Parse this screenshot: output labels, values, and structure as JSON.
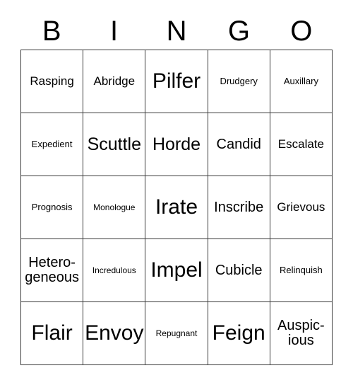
{
  "card": {
    "header_letters": [
      "B",
      "I",
      "N",
      "G",
      "O"
    ],
    "columns": 5,
    "rows": 5,
    "border_color": "#3a3a3a",
    "text_color": "#000000",
    "background_color": "#ffffff",
    "cells": [
      [
        {
          "text": "Rasping",
          "size": "sm"
        },
        {
          "text": "Abridge",
          "size": "sm"
        },
        {
          "text": "Pilfer",
          "size": "xl"
        },
        {
          "text": "Drudgery",
          "size": "xs"
        },
        {
          "text": "Auxillary",
          "size": "xs"
        }
      ],
      [
        {
          "text": "Expedient",
          "size": "xs"
        },
        {
          "text": "Scuttle",
          "size": "lg"
        },
        {
          "text": "Horde",
          "size": "lg"
        },
        {
          "text": "Candid",
          "size": "md"
        },
        {
          "text": "Escalate",
          "size": "sm"
        }
      ],
      [
        {
          "text": "Prognosis",
          "size": "xs"
        },
        {
          "text": "Monologue",
          "size": "xxs"
        },
        {
          "text": "Irate",
          "size": "xl"
        },
        {
          "text": "Inscribe",
          "size": "md"
        },
        {
          "text": "Grievous",
          "size": "sm"
        }
      ],
      [
        {
          "text": "Hetero-\ngeneous",
          "size": "md"
        },
        {
          "text": "Incredulous",
          "size": "xxs"
        },
        {
          "text": "Impel",
          "size": "xl"
        },
        {
          "text": "Cubicle",
          "size": "md"
        },
        {
          "text": "Relinquish",
          "size": "xs"
        }
      ],
      [
        {
          "text": "Flair",
          "size": "xl"
        },
        {
          "text": "Envoy",
          "size": "xl"
        },
        {
          "text": "Repugnant",
          "size": "xxs"
        },
        {
          "text": "Feign",
          "size": "xl"
        },
        {
          "text": "Auspic-\nious",
          "size": "md"
        }
      ]
    ]
  }
}
